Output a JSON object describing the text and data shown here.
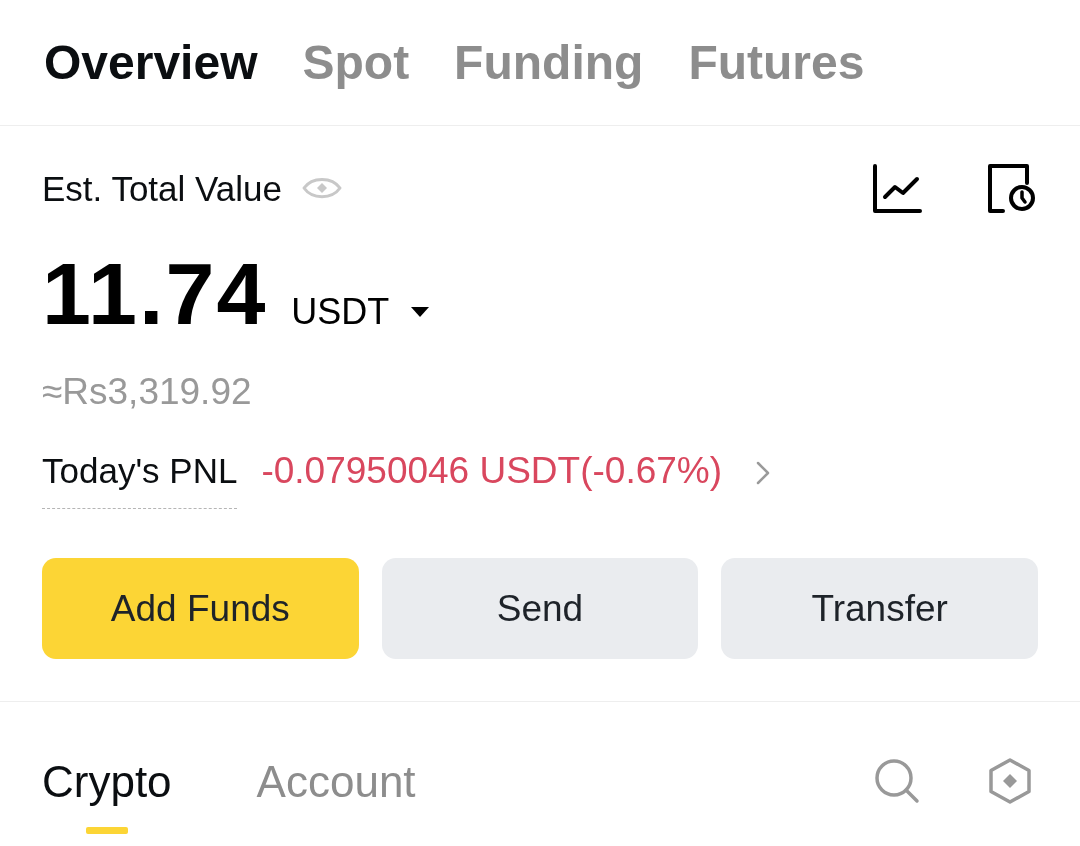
{
  "tabs": [
    {
      "label": "Overview",
      "selected": true
    },
    {
      "label": "Spot",
      "selected": false
    },
    {
      "label": "Funding",
      "selected": false
    },
    {
      "label": "Futures",
      "selected": false
    }
  ],
  "summary": {
    "title": "Est. Total Value",
    "amount": "11.74",
    "currency": "USDT",
    "fiat": "≈Rs3,319.92",
    "pnl": {
      "label": "Today's PNL",
      "value": "-0.07950046 USDT(-0.67%)",
      "negative": true
    }
  },
  "actions": [
    {
      "label": "Add Funds",
      "primary": true
    },
    {
      "label": "Send",
      "primary": false
    },
    {
      "label": "Transfer",
      "primary": false
    }
  ],
  "asset_tabs": [
    {
      "label": "Crypto",
      "selected": true
    },
    {
      "label": "Account",
      "selected": false
    }
  ]
}
